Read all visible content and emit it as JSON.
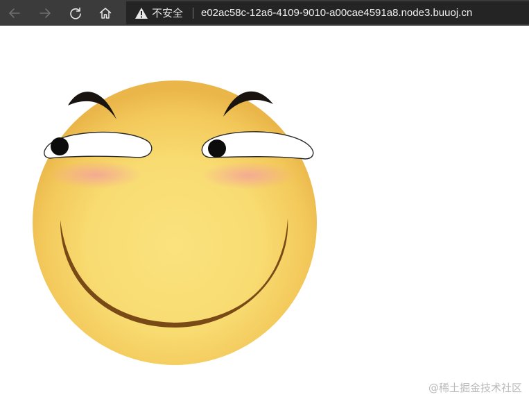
{
  "browser": {
    "security_label": "不安全",
    "url": "e02ac58c-12a6-4109-9010-a00cae4591a8.node3.buuoj.cn",
    "nav_icons": [
      "back-arrow-icon",
      "forward-arrow-icon",
      "reload-icon",
      "home-icon",
      "warning-icon"
    ]
  },
  "page": {
    "image_subject": "smiling-emoji-face",
    "watermark": "@稀土掘金技术社区"
  }
}
